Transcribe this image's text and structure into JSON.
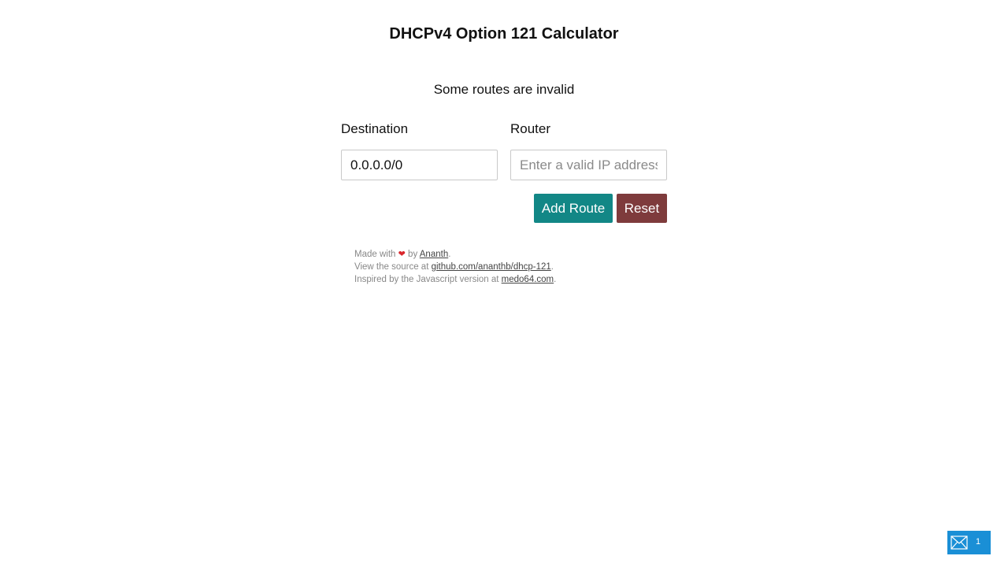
{
  "page": {
    "title": "DHCPv4 Option 121 Calculator",
    "status_message": "Some routes are invalid"
  },
  "form": {
    "destination_label": "Destination",
    "destination_value": "0.0.0.0/0",
    "router_label": "Router",
    "router_placeholder": "Enter a valid IP address",
    "router_value": "",
    "add_route_label": "Add Route",
    "reset_label": "Reset"
  },
  "footer": {
    "line1_prefix": "Made with",
    "heart": "❤",
    "line1_mid": "by",
    "author_link": "Ananth",
    "line1_suffix": ".",
    "line2_prefix": "View the source at",
    "source_link": "github.com/ananthb/dhcp-121",
    "line2_suffix": ".",
    "line3_prefix": "Inspired by the Javascript version at",
    "inspiration_link": "medo64.com",
    "line3_suffix": "."
  },
  "badge": {
    "count": "1",
    "icon": "envelope-icon"
  },
  "colors": {
    "add_button": "#128786",
    "reset_button": "#7e3b3c",
    "badge": "#1a8fd6",
    "heart": "#d9262c"
  }
}
